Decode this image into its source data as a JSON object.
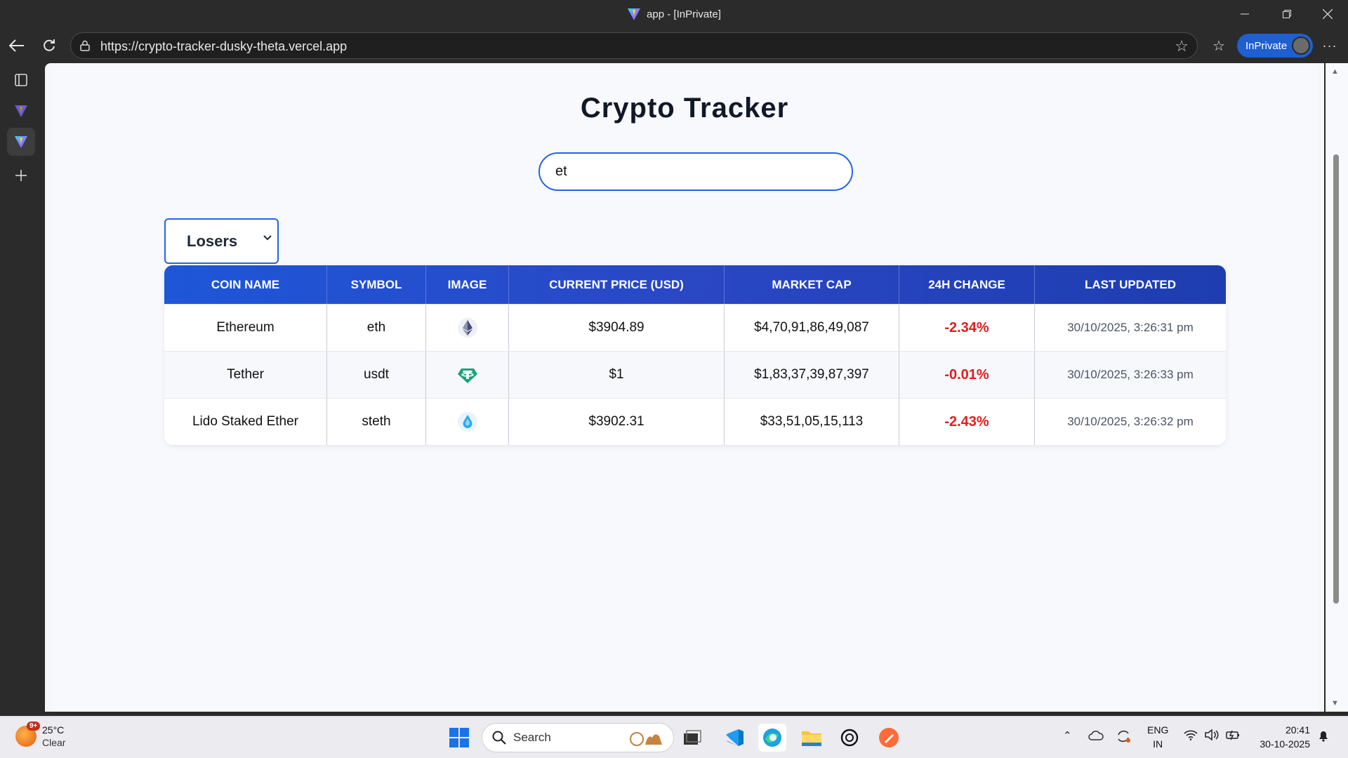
{
  "window": {
    "title": "app - [InPrivate]"
  },
  "browser": {
    "url": "https://crypto-tracker-dusky-theta.vercel.app",
    "inprivate_label": "InPrivate"
  },
  "app": {
    "title": "Crypto Tracker",
    "search_value": "et",
    "filter_selected": "Losers",
    "columns": [
      "COIN NAME",
      "SYMBOL",
      "IMAGE",
      "CURRENT PRICE (USD)",
      "MARKET CAP",
      "24H CHANGE",
      "LAST UPDATED"
    ],
    "rows": [
      {
        "name": "Ethereum",
        "symbol": "eth",
        "icon": "ethereum-icon",
        "price": "$3904.89",
        "market_cap": "$4,70,91,86,49,087",
        "change": "-2.34%",
        "updated": "30/10/2025, 3:26:31 pm"
      },
      {
        "name": "Tether",
        "symbol": "usdt",
        "icon": "tether-icon",
        "price": "$1",
        "market_cap": "$1,83,37,39,87,397",
        "change": "-0.01%",
        "updated": "30/10/2025, 3:26:33 pm"
      },
      {
        "name": "Lido Staked Ether",
        "symbol": "steth",
        "icon": "lido-icon",
        "price": "$3902.31",
        "market_cap": "$33,51,05,15,113",
        "change": "-2.43%",
        "updated": "30/10/2025, 3:26:32 pm"
      }
    ],
    "colors": {
      "accent": "#2563eb",
      "negative": "#e11d1d",
      "header_start": "#1e56d8",
      "header_end": "#1d3db0"
    }
  },
  "taskbar": {
    "weather_temp": "25°C",
    "weather_desc": "Clear",
    "weather_badge": "9+",
    "search_placeholder": "Search",
    "lang_line1": "ENG",
    "lang_line2": "IN",
    "time": "20:41",
    "date": "30-10-2025"
  }
}
